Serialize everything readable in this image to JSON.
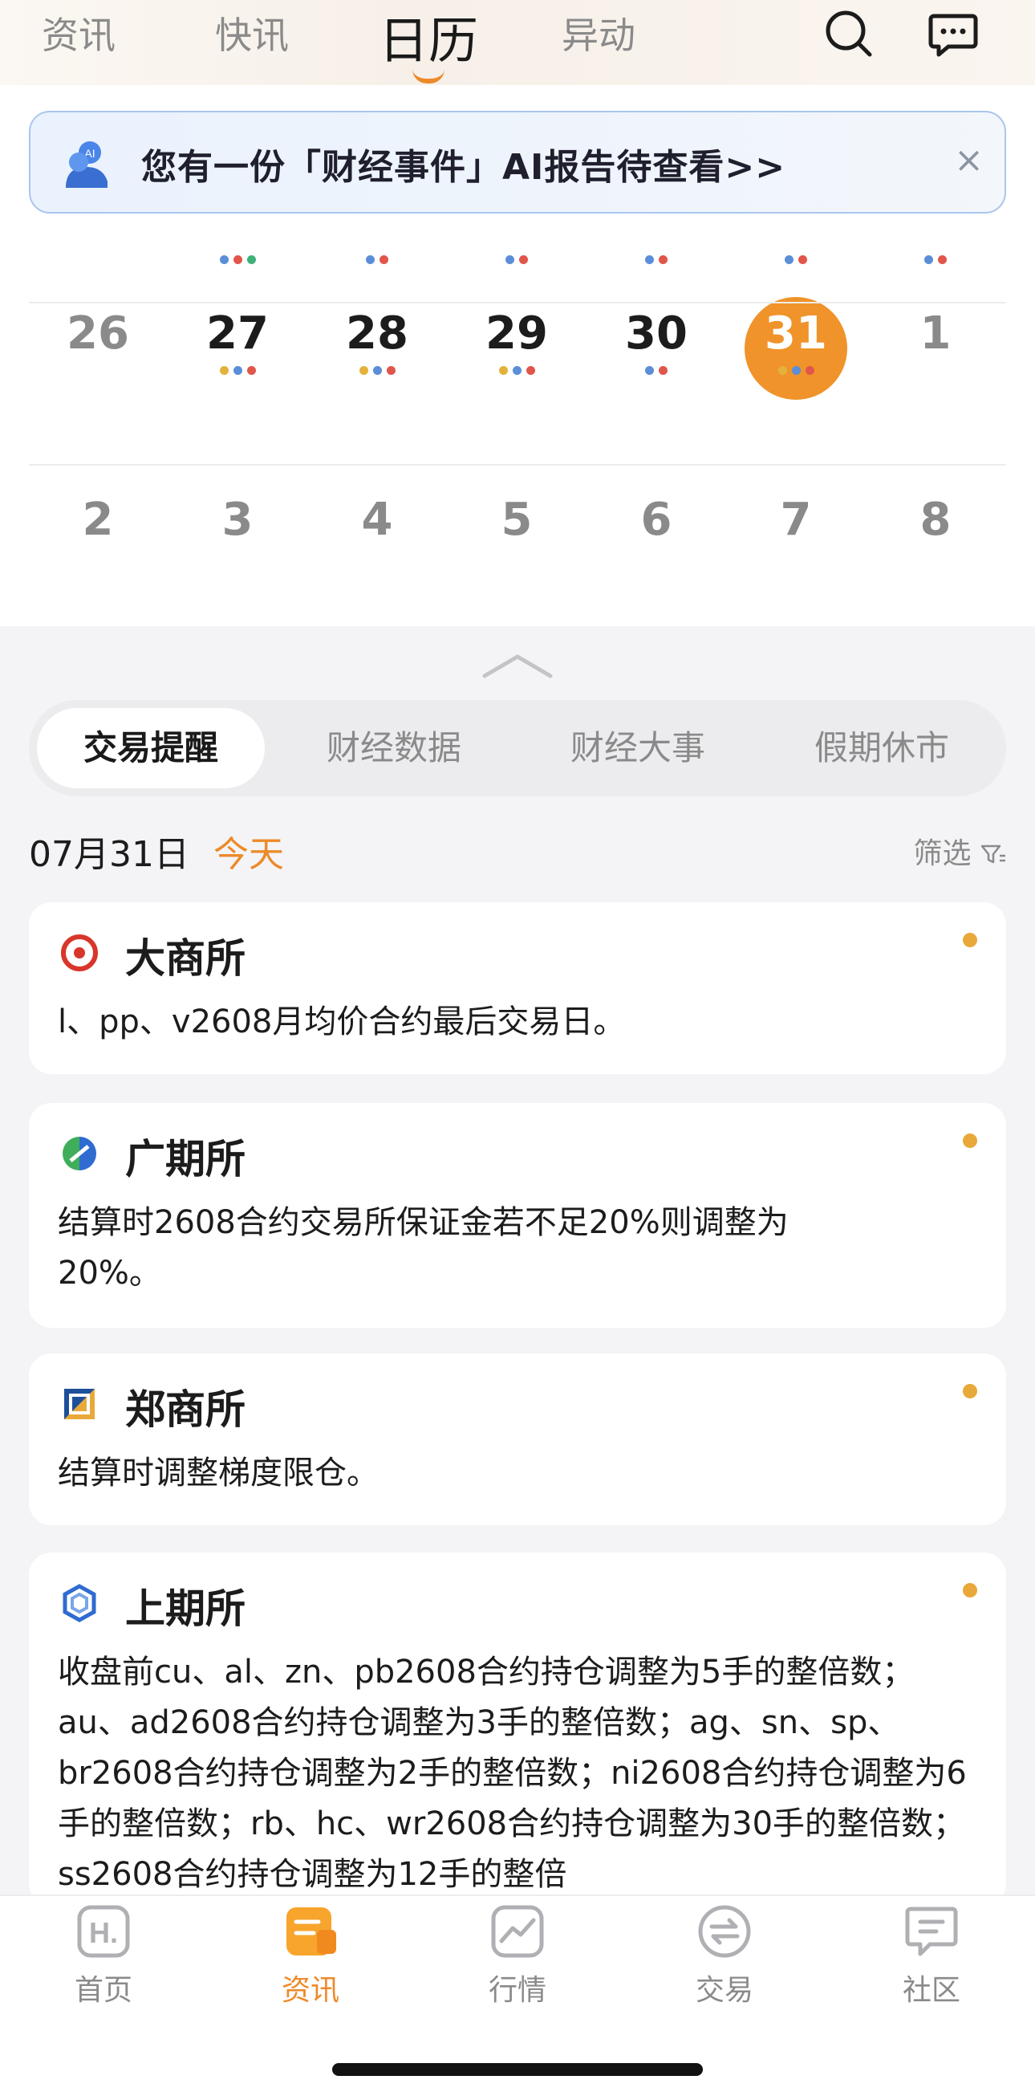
{
  "top_tabs": [
    {
      "label": "资讯"
    },
    {
      "label": "快讯"
    },
    {
      "label": "日历"
    },
    {
      "label": "异动"
    }
  ],
  "top_icons": [
    "search-icon",
    "message-icon"
  ],
  "ai_banner": {
    "avatar_label": "AI",
    "text": "您有一份「财经事件」AI报告待查看>>",
    "close": "×"
  },
  "calendar": {
    "row1": [
      "26",
      "27",
      "28",
      "29",
      "30",
      "31",
      "1"
    ],
    "row2": [
      "2",
      "3",
      "4",
      "5",
      "6",
      "7",
      "8"
    ],
    "selected": "31"
  },
  "colors": {
    "accent": "#ec8a2a",
    "today_circle": "#f0932a",
    "dot_blue": "#5b8ed8",
    "dot_red": "#e0564a",
    "dot_green": "#3fb07a",
    "dot_yellow": "#e4b23a",
    "unread_dot": "#e8a93a"
  },
  "segments": [
    {
      "label": "交易提醒"
    },
    {
      "label": "财经数据"
    },
    {
      "label": "财经大事"
    },
    {
      "label": "假期休市"
    }
  ],
  "date_line": {
    "date": "07月31日",
    "today": "今天",
    "filter": "筛选"
  },
  "events": [
    {
      "exchange": "大商所",
      "text": "l、pp、v2608月均价合约最后交易日。"
    },
    {
      "exchange": "广期所",
      "text": "结算时2608合约交易所保证金若不足20%则调整为20%。"
    },
    {
      "exchange": "郑商所",
      "text": "结算时调整梯度限仓。"
    },
    {
      "exchange": "上期所",
      "text": "收盘前cu、al、zn、pb2608合约持仓调整为5手的整倍数；au、ad2608合约持仓调整为3手的整倍数；ag、sn、sp、br2608合约持仓调整为2手的整倍数；ni2608合约持仓调整为6手的整倍数；rb、hc、wr2608合约持仓调整为30手的整倍数；ss2608合约持仓调整为12手的整倍"
    }
  ],
  "bottom_nav": [
    {
      "label": "首页"
    },
    {
      "label": "资讯"
    },
    {
      "label": "行情"
    },
    {
      "label": "交易"
    },
    {
      "label": "社区"
    }
  ]
}
